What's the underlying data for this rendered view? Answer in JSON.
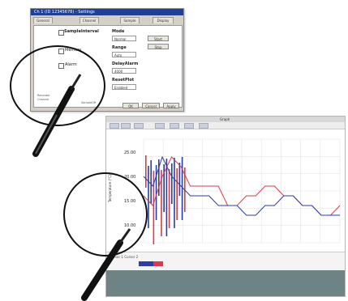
{
  "dialog": {
    "title": "Ch 1 (ID 12345678) - Settings",
    "tabs": [
      "General",
      "Channel",
      "Sample",
      "Display"
    ],
    "tree": {
      "root": "SampleInterval",
      "items": [
        "Memory",
        "Alarm"
      ],
      "footer": [
        "Recorder",
        "Channel"
      ]
    },
    "fields": {
      "mode_label": "Mode",
      "mode_value": "Normal",
      "range_label": "Range",
      "range_value": "Auto",
      "delay_label": "DelayAlarm",
      "delay_value": "4000",
      "reset_label": "ResetPlot",
      "reset_value": "Enabled"
    },
    "side_buttons": [
      "Start",
      "Stop"
    ],
    "footer_label": "SampleOff",
    "ok_label": "OK",
    "cancel_label": "Cancel",
    "apply_label": "Apply"
  },
  "window": {
    "title": "Graph",
    "panel_text": "Cursor 1  Cursor 2",
    "y_ticks": [
      "25.00",
      "20.00",
      "15.00",
      "10.00"
    ],
    "y_label": "Temperature (°C)"
  },
  "chart_data": {
    "type": "line",
    "series": [
      {
        "name": "",
        "color": "#d93b4a",
        "values": [
          4,
          3,
          6,
          8,
          7,
          5,
          5,
          5,
          5,
          3,
          3,
          4,
          4,
          5,
          5,
          4,
          4,
          3,
          3,
          2,
          2,
          3
        ]
      },
      {
        "name": "",
        "color": "#2b3da8",
        "values": [
          6,
          5,
          8,
          6,
          5,
          4,
          4,
          4,
          3,
          3,
          3,
          2,
          2,
          3,
          3,
          4,
          4,
          3,
          3,
          2,
          2,
          2
        ]
      }
    ]
  }
}
